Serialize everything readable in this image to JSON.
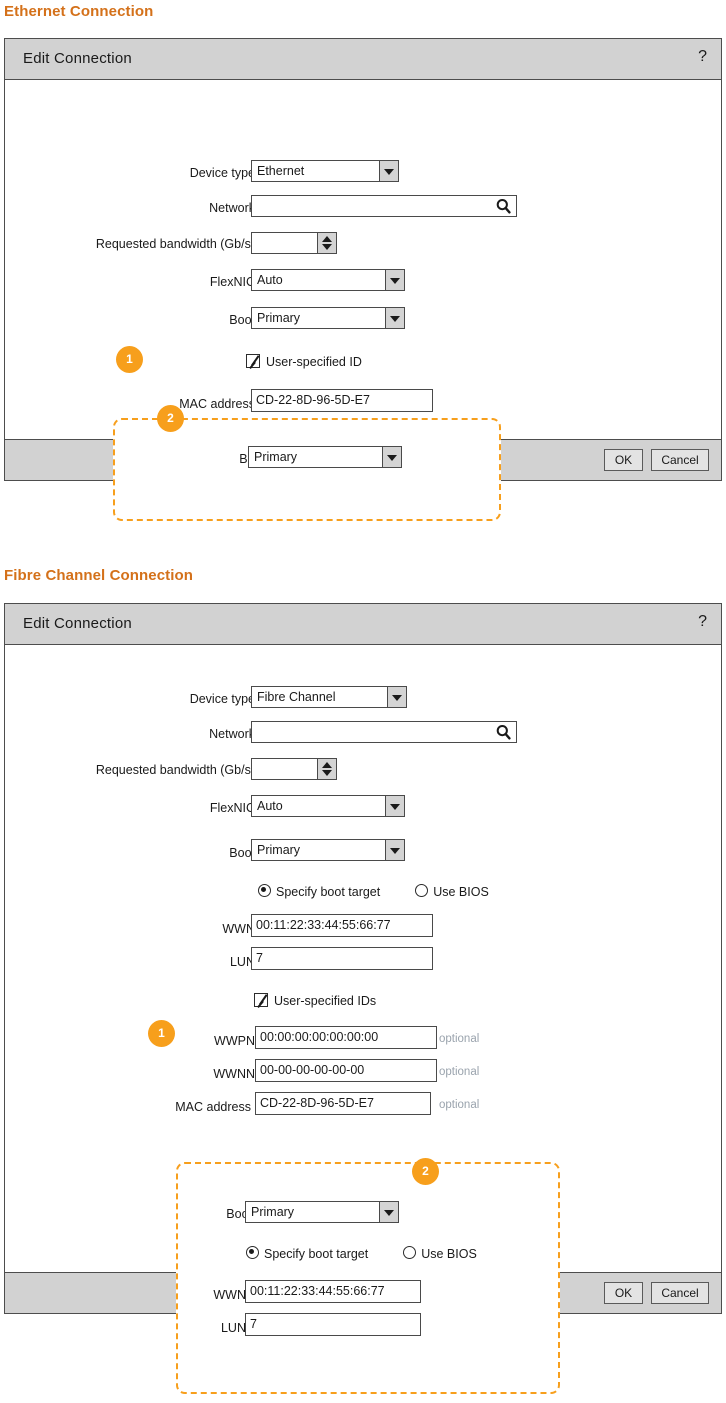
{
  "sections": [
    {
      "heading": "Ethernet Connection",
      "dialog": {
        "title": "Edit Connection",
        "help_icon": "question-mark-icon",
        "fields": {
          "device_type_label": "Device type",
          "device_type_value": "Ethernet",
          "network_label": "Network",
          "network_value": "",
          "network_icon": "search-icon",
          "bandwidth_label": "Requested bandwidth (Gb/s)",
          "bandwidth_value": "",
          "flexnic_label": "FlexNIC",
          "flexnic_value": "Auto",
          "boot_label": "Boot",
          "boot_value": "Primary",
          "user_specified_label": "User-specified ID",
          "mac_label": "MAC address",
          "mac_value": "CD-22-8D-96-5D-E7"
        },
        "footer": {
          "ok": "OK",
          "cancel": "Cancel"
        }
      },
      "callouts": [
        {
          "number": "1"
        },
        {
          "number": "2",
          "boot_label": "Boot",
          "boot_value": "Primary"
        }
      ]
    },
    {
      "heading": "Fibre Channel Connection",
      "dialog": {
        "title": "Edit Connection",
        "help_icon": "question-mark-icon",
        "fields": {
          "device_type_label": "Device type",
          "device_type_value": "Fibre Channel",
          "network_label": "Network",
          "network_value": "",
          "network_icon": "search-icon",
          "bandwidth_label": "Requested bandwidth (Gb/s)",
          "bandwidth_value": "",
          "flexnic_label": "FlexNIC",
          "flexnic_value": "Auto",
          "boot_label": "Boot",
          "boot_value": "Primary",
          "radio_specify": "Specify boot target",
          "radio_bios": "Use BIOS",
          "wwn_label": "WWN",
          "wwn_value": "00:11:22:33:44:55:66:77",
          "lun_label": "LUN",
          "lun_value": "7",
          "user_specified_label": "User-specified IDs",
          "wwpn_label": "WWPN",
          "wwpn_value": "00:00:00:00:00:00:00",
          "wwpn_hint": "optional",
          "wwnn_label": "WWNN",
          "wwnn_value": "00-00-00-00-00-00",
          "wwnn_hint": "optional",
          "mac_label": "MAC address",
          "mac_value": "CD-22-8D-96-5D-E7",
          "mac_hint": "optional"
        },
        "footer": {
          "ok": "OK",
          "cancel": "Cancel"
        }
      },
      "callouts": [
        {
          "number": "1"
        },
        {
          "number": "2",
          "boot_label": "Boot",
          "boot_value": "Primary",
          "radio_specify": "Specify boot target",
          "radio_bios": "Use BIOS",
          "wwn_label": "WWN",
          "wwn_value": "00:11:22:33:44:55:66:77",
          "lun_label": "LUN",
          "lun_value": "7"
        }
      ]
    }
  ],
  "colors": {
    "accent_orange": "#f79f1c",
    "heading_orange": "#d4711a",
    "chrome_gray": "#d2d2d2",
    "border_gray": "#4d4d4d",
    "hint_gray": "#9aa3ad"
  }
}
